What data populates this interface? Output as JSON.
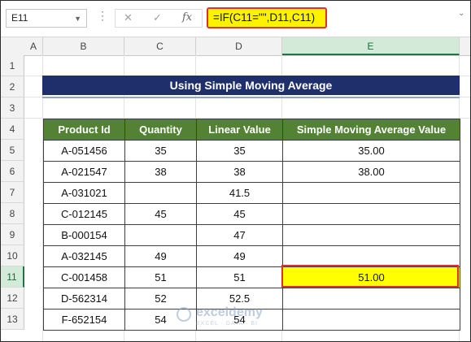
{
  "formula_bar": {
    "name_box": "E11",
    "name_box_dropdown_icon": "chevron-down-icon",
    "more_icon": "vertical-dots-icon",
    "cancel_icon": "✕",
    "enter_icon": "✓",
    "fx_label": "fx",
    "formula": "=IF(C11=\"\",D11,C11)",
    "expand_icon": "chevron-down-icon",
    "highlight_color": "#fff200",
    "outline_color": "#e0302a"
  },
  "columns": [
    "A",
    "B",
    "C",
    "D",
    "E"
  ],
  "selected_column": "E",
  "rows": [
    "1",
    "2",
    "3",
    "4",
    "5",
    "6",
    "7",
    "8",
    "9",
    "10",
    "11",
    "12",
    "13"
  ],
  "selected_row": "11",
  "title": "Using Simple Moving Average",
  "table": {
    "headers": [
      "Product Id",
      "Quantity",
      "Linear Value",
      "Simple Moving Average Value"
    ],
    "header_color": "#548235",
    "rows": [
      [
        "A-051456",
        "35",
        "35",
        "35.00"
      ],
      [
        "A-021547",
        "38",
        "38",
        "38.00"
      ],
      [
        "A-031021",
        "",
        "41.5",
        ""
      ],
      [
        "C-012145",
        "45",
        "45",
        ""
      ],
      [
        "B-000154",
        "",
        "47",
        ""
      ],
      [
        "A-032145",
        "49",
        "49",
        ""
      ],
      [
        "C-001458",
        "51",
        "51",
        "51.00"
      ],
      [
        "D-562314",
        "52",
        "52.5",
        ""
      ],
      [
        "F-652154",
        "54",
        "54",
        ""
      ]
    ],
    "highlight_row_index": 6,
    "highlight_color": "#ffff00"
  },
  "watermark": {
    "name": "exceldemy",
    "tagline": "EXCEL · DATA · BI"
  }
}
